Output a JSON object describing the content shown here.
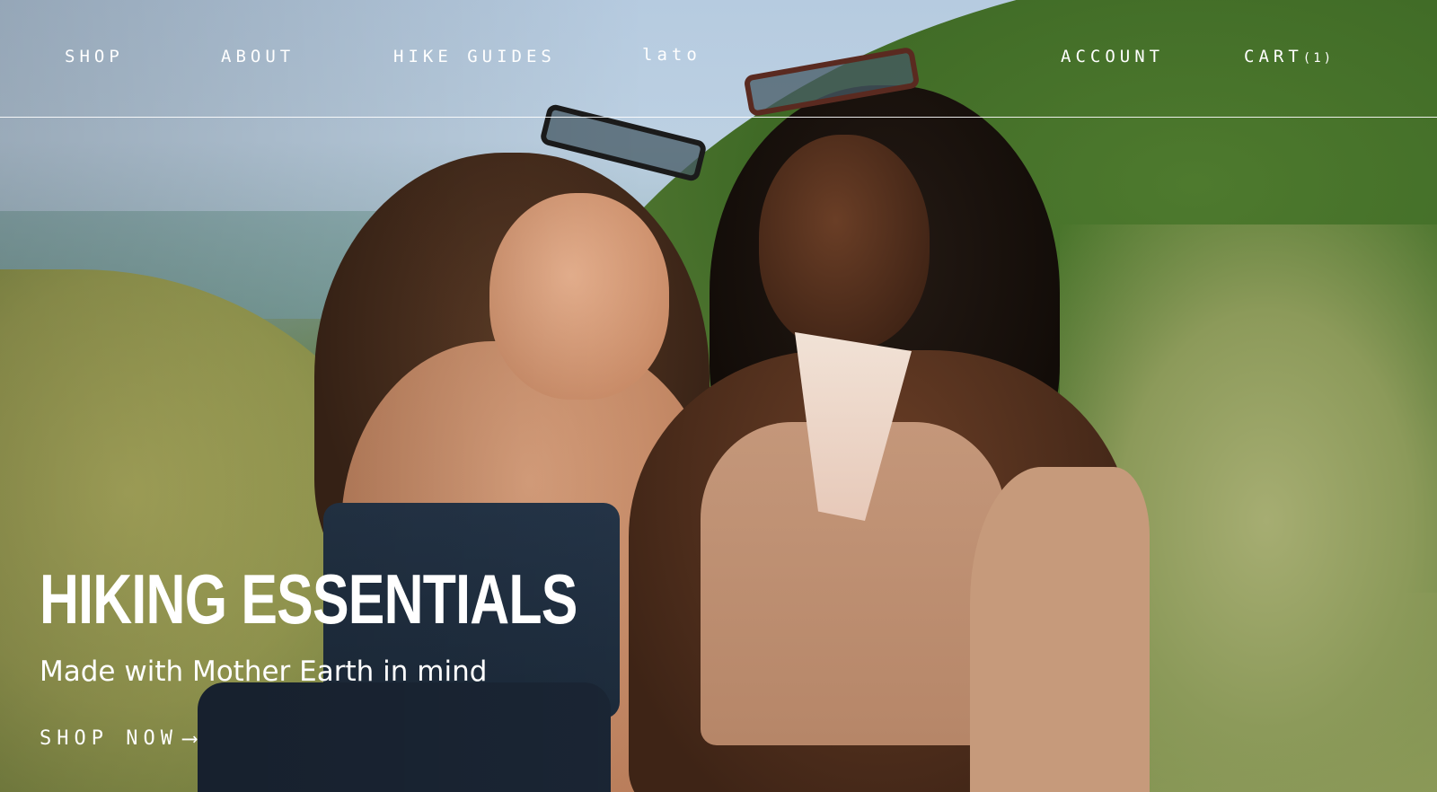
{
  "nav": {
    "left_items": [
      "SHOP",
      "ABOUT",
      "HIKE GUIDES"
    ],
    "logo": "lato",
    "account_label": "ACCOUNT",
    "cart_label": "CART",
    "cart_count": "(1)"
  },
  "hero": {
    "title": "HIKING ESSENTIALS",
    "subtitle": "Made with Mother Earth in mind",
    "cta_label": "SHOP NOW",
    "cta_icon": "arrow-right-icon"
  },
  "colors": {
    "text": "#ffffff",
    "rule": "#ffffff"
  }
}
